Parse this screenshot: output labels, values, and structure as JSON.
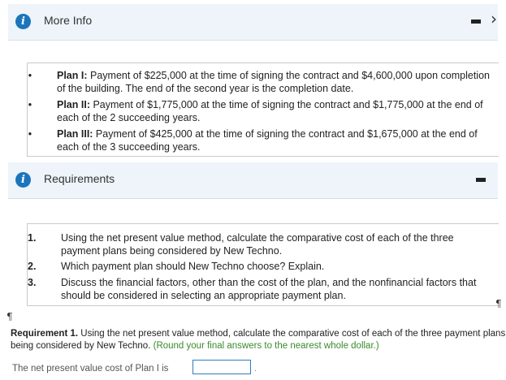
{
  "more_info": {
    "title": "More Info",
    "plans": [
      {
        "label": "Plan I:",
        "text": " Payment of $225,000 at the time of signing the contract and $4,600,000 upon completion of the building. The end of the second year is the completion date."
      },
      {
        "label": "Plan II:",
        "text": " Payment of $1,775,000 at the time of signing the contract and $1,775,000 at the end of each of the 2 succeeding years."
      },
      {
        "label": "Plan III:",
        "text": " Payment of $425,000 at the time of signing the contract and $1,675,000 at the end of each of the 3 succeeding years."
      }
    ]
  },
  "requirements": {
    "title": "Requirements",
    "items": [
      {
        "num": "1.",
        "text": "Using the net present value method, calculate the comparative cost of each of the three payment plans being considered by New Techno."
      },
      {
        "num": "2.",
        "text": "Which payment plan should New Techno choose? Explain."
      },
      {
        "num": "3.",
        "text": "Discuss the financial factors, other than the cost of the plan, and the nonfinancial factors that should be considered in selecting an appropriate payment plan."
      }
    ]
  },
  "pilcrow": "¶",
  "question": {
    "heading": "Requirement 1.",
    "body": " Using the net present value method, calculate the comparative cost of each of the three payment plans being considered by New Techno. ",
    "hint": "(Round your final answers to the nearest whole dollar.)",
    "npv_label": "The net present value cost of Plan I is",
    "npv_value": "",
    "trailing": "."
  },
  "colors": {
    "accent": "#1b75bb",
    "header_bg": "#eef4fa",
    "hint_green": "#3a8a2a"
  }
}
